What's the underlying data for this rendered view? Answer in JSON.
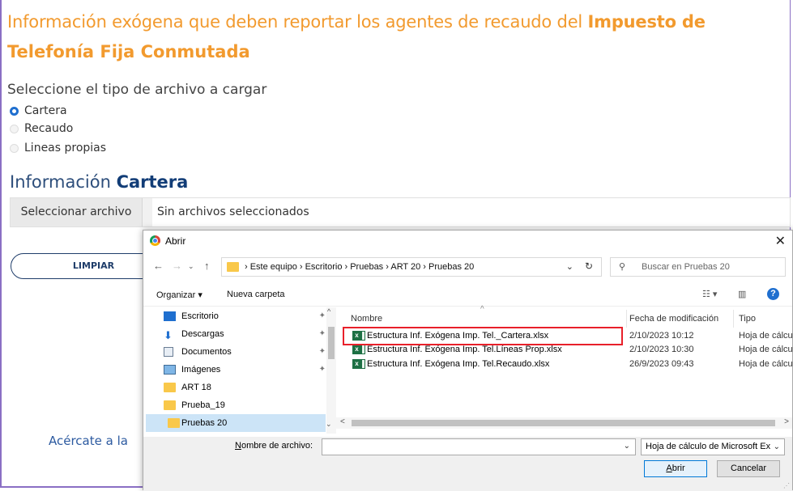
{
  "page": {
    "heading_part1": "Información exógena que deben reportar los agentes de recaudo del ",
    "heading_bold": "Impuesto de",
    "heading_line2": "Telefonía Fija Conmutada",
    "select_title": "Seleccione el tipo de archivo a cargar",
    "radios": [
      {
        "label": "Cartera",
        "selected": true
      },
      {
        "label": "Recaudo",
        "selected": false
      },
      {
        "label": "Lineas propias",
        "selected": false
      }
    ],
    "info_prefix": "Información ",
    "info_bold": "Cartera",
    "file_button": "Seleccionar archivo",
    "file_status": "Sin archivos seleccionados",
    "clear_button": "LIMPIAR",
    "footer_text": "Acércate a la"
  },
  "dialog": {
    "title": "Abrir",
    "close": "✕",
    "path": "›  Este equipo  ›  Escritorio  ›  Pruebas  ›  ART 20  ›  Pruebas 20",
    "search_placeholder": "Buscar en Pruebas 20",
    "organize": "Organizar ▾",
    "new_folder": "Nueva carpeta",
    "nav_items": [
      {
        "label": "Escritorio",
        "icon": "desktop-icon",
        "pinned": true
      },
      {
        "label": "Descargas",
        "icon": "download-icon",
        "pinned": true
      },
      {
        "label": "Documentos",
        "icon": "document-icon",
        "pinned": true
      },
      {
        "label": "Imágenes",
        "icon": "image-icon",
        "pinned": true
      },
      {
        "label": "ART 18",
        "icon": "folder-icon",
        "pinned": false
      },
      {
        "label": "Prueba_19",
        "icon": "folder-icon",
        "pinned": false
      },
      {
        "label": "Pruebas 20",
        "icon": "folder-icon",
        "pinned": false,
        "selected": true
      }
    ],
    "columns": {
      "name": "Nombre",
      "date": "Fecha de modificación",
      "type": "Tipo"
    },
    "files": [
      {
        "name": "Estructura Inf. Exógena Imp. Tel._Cartera.xlsx",
        "date": "2/10/2023 10:12",
        "type": "Hoja de cálcul"
      },
      {
        "name": "Estructura Inf. Exógena Imp. Tel.Líneas Prop.xlsx",
        "date": "2/10/2023 10:30",
        "type": "Hoja de cálcul"
      },
      {
        "name": "Estructura Inf. Exógena Imp. Tel.Recaudo.xlsx",
        "date": "26/9/2023 09:43",
        "type": "Hoja de cálcul"
      }
    ],
    "filename_label_pre": "N",
    "filename_label_rest": "ombre de archivo:",
    "filename_value": "",
    "filetype": "Hoja de cálculo de Microsoft Ex",
    "open_pre": "",
    "open_u": "A",
    "open_rest": "brir",
    "cancel": "Cancelar",
    "highlight_color": "#e8202a"
  }
}
